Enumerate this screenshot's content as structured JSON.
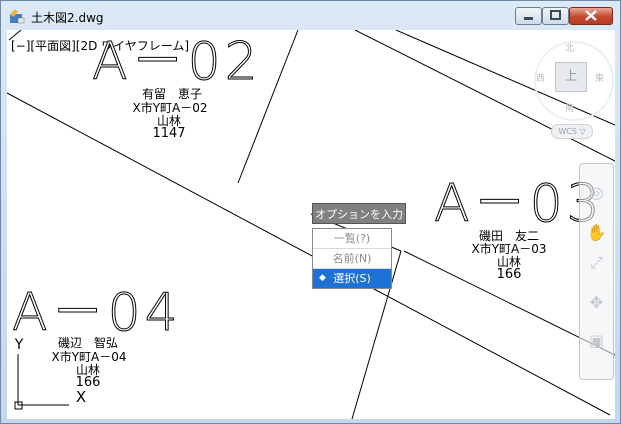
{
  "window": {
    "title": "土木図2.dwg"
  },
  "viewport": {
    "label": "[−][平面図][2D ワイヤフレーム]"
  },
  "parcels": [
    {
      "id": "A－02",
      "owner": "有留　恵子",
      "address": "X市Y町A－02",
      "land_use": "山林",
      "area": "1147"
    },
    {
      "id": "A－03",
      "owner": "磯田　友二",
      "address": "X市Y町A－03",
      "land_use": "山林",
      "area": "166"
    },
    {
      "id": "A－04",
      "owner": "磯辺　智弘",
      "address": "X市Y町A－04",
      "land_use": "山林",
      "area": "166"
    }
  ],
  "ucs": {
    "y": "Y",
    "x": "X"
  },
  "viewcube": {
    "face": "上",
    "north": "北",
    "south": "南",
    "east": "東",
    "west": "西",
    "wcs": "WCS ▽"
  },
  "prompt": {
    "tooltip": "オプションを入力",
    "options": [
      {
        "label": "一覧(?)",
        "selected": false
      },
      {
        "label": "名前(N)",
        "selected": false
      },
      {
        "label": "選択(S)",
        "selected": true
      }
    ],
    "bullet": "◆"
  },
  "colors": {
    "selection": "#1e72d6",
    "close_button": "#c6472f"
  }
}
